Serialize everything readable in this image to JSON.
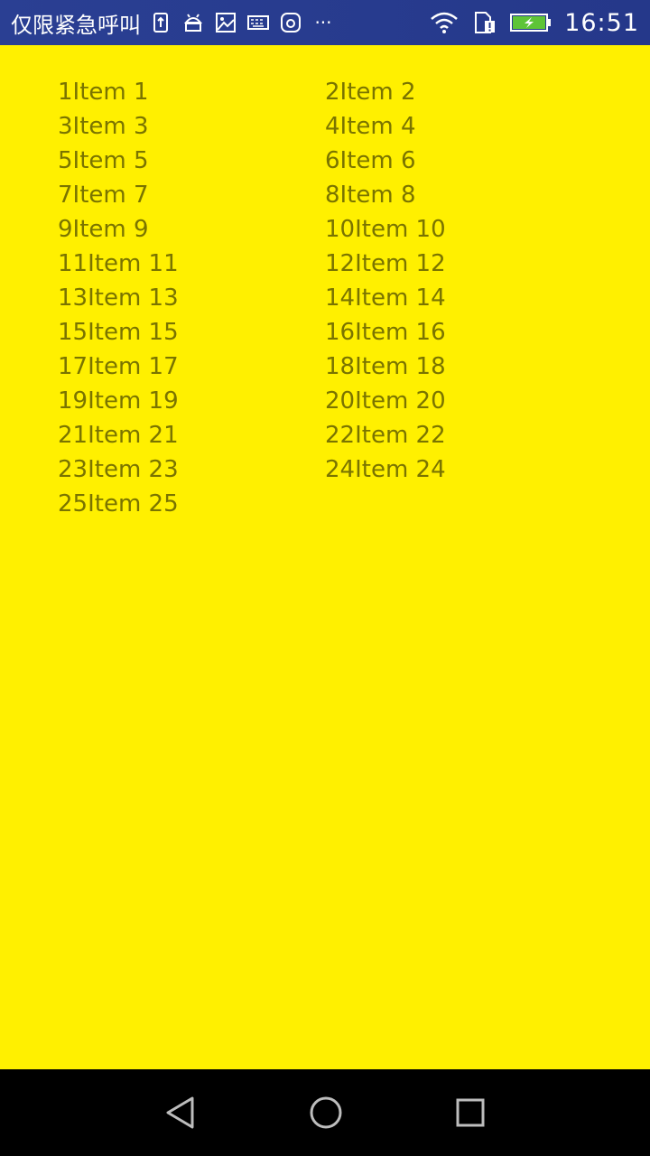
{
  "status_bar": {
    "carrier": "仅限紧急呼叫",
    "time": "16:51",
    "icons": [
      "sim-upload-icon",
      "android-icon",
      "image-icon",
      "keyboard-icon",
      "app-icon",
      "more-dots-icon",
      "wifi-icon",
      "sim-alert-icon",
      "battery-charging-icon"
    ],
    "more": "···"
  },
  "items": [
    "1Item 1",
    "2Item 2",
    "3Item 3",
    "4Item 4",
    "5Item 5",
    "6Item 6",
    "7Item 7",
    "8Item 8",
    "9Item 9",
    "10Item 10",
    "11Item 11",
    "12Item 12",
    "13Item 13",
    "14Item 14",
    "15Item 15",
    "16Item 16",
    "17Item 17",
    "18Item 18",
    "19Item 19",
    "20Item 20",
    "21Item 21",
    "22Item 22",
    "23Item 23",
    "24Item 24",
    "25Item 25"
  ],
  "colors": {
    "background": "#fff000",
    "item_text": "#7a7400",
    "status_bar": "#2a3f93",
    "nav_bar": "#000000"
  },
  "nav": {
    "back": "back-triangle-icon",
    "home": "home-circle-icon",
    "recent": "recent-square-icon"
  }
}
